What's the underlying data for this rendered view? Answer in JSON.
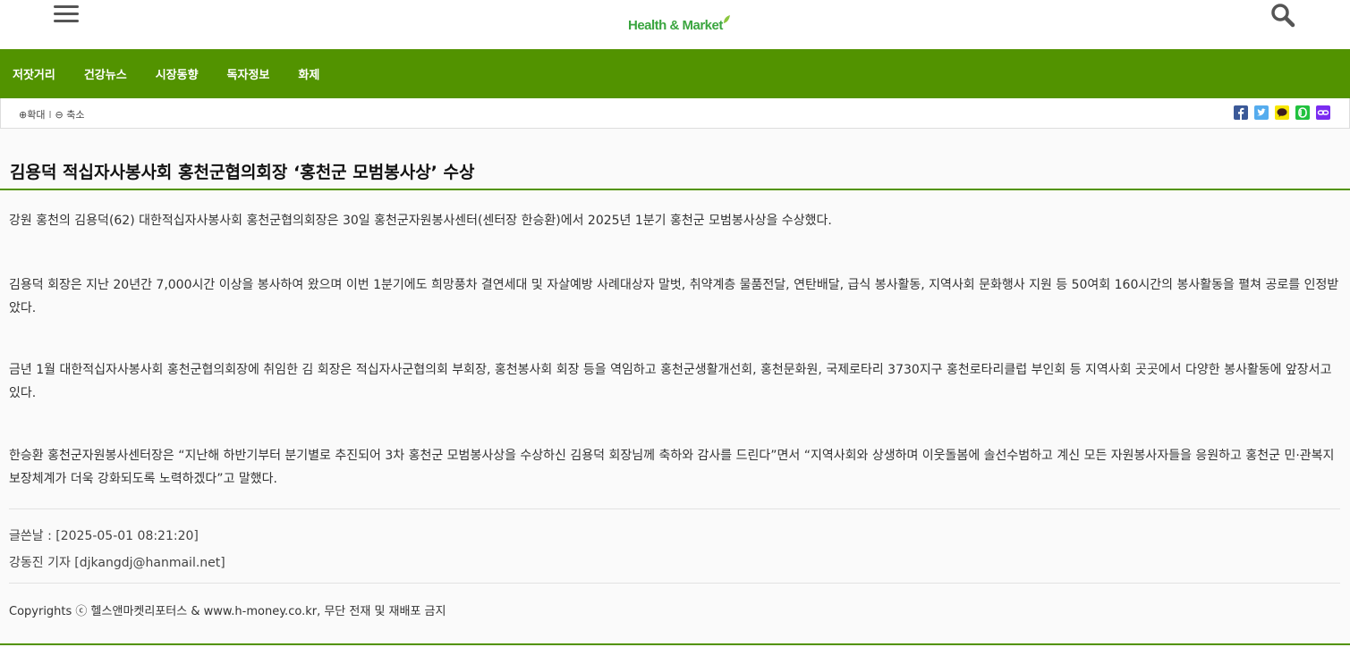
{
  "header": {
    "logo_text": "Health & Market",
    "menu_icon": "hamburger-menu-icon",
    "search_icon": "search-icon"
  },
  "nav": {
    "items": [
      "저잣거리",
      "건강뉴스",
      "시장동향",
      "독자정보",
      "화제"
    ]
  },
  "toolbar": {
    "zoom_in": "⊕확대",
    "separator": "l",
    "zoom_out": "⊖ 축소",
    "share_icons": [
      "facebook-icon",
      "twitter-icon",
      "kakaotalk-icon",
      "band-icon",
      "link-icon"
    ]
  },
  "colors": {
    "brand_green": "#529300",
    "logo_green": "#3aa53f",
    "facebook": "#3b5998",
    "twitter": "#55acee",
    "kakao": "#f7e600",
    "band": "#21c23f",
    "link": "#7a2cf0"
  },
  "article": {
    "title": "김용덕 적십자사봉사회 홍천군협의회장 ‘홍천군 모범봉사상’ 수상",
    "paragraphs": [
      "강원 홍천의 김용덕(62) 대한적십자사봉사회 홍천군협의회장은 30일 홍천군자원봉사센터(센터장 한승환)에서 2025년 1분기 홍천군 모범봉사상을 수상했다.",
      "김용덕 회장은 지난 20년간 7,000시간 이상을 봉사하여 왔으며 이번 1분기에도 희망풍차 결연세대 및 자살예방 사례대상자 말벗, 취약계층 물품전달, 연탄배달, 급식 봉사활동, 지역사회 문화행사 지원 등 50여회 160시간의 봉사활동을 펼쳐 공로를 인정받았다.",
      "금년 1월 대한적십자사봉사회 홍천군협의회장에 취임한 김 회장은 적십자사군협의회 부회장, 홍천봉사회 회장 등을 역임하고 홍천군생활개선회, 홍천문화원, 국제로타리 3730지구 홍천로타리클럽 부인회 등 지역사회 곳곳에서 다양한 봉사활동에 앞장서고 있다.",
      "한승환 홍천군자원봉사센터장은 “지난해 하반기부터 분기별로 추진되어 3차 홍천군 모범봉사상을 수상하신 김용덕 회장님께 축하와 감사를 드린다”면서 “지역사회와 상생하며 이웃돌봄에 솔선수범하고 계신 모든 자원봉사자들을 응원하고 홍천군 민·관복지보장체계가 더욱 강화되도록 노력하겠다”고 말했다."
    ],
    "date": "글쓴날 : [2025-05-01 08:21:20]",
    "reporter": "강동진 기자 [djkangdj@hanmail.net]",
    "copyright": "Copyrights ⓒ 헬스앤마켓리포터스 & www.h-money.co.kr, 무단 전재 및 재배포 금지"
  }
}
